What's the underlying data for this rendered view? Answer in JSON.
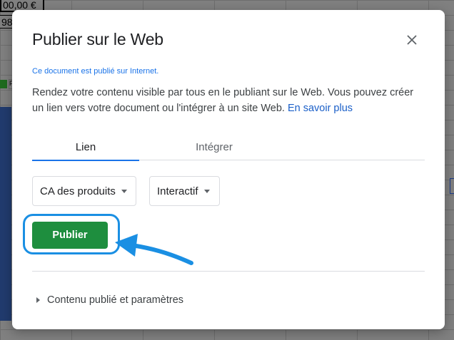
{
  "background": {
    "cell_value_1": "00,00 €",
    "cell_value_2": "98,",
    "legend_letter": "F"
  },
  "dialog": {
    "title": "Publier sur le Web",
    "close_icon": "close-icon",
    "status_text": "Ce document est publié sur Internet.",
    "description": "Rendez votre contenu visible par tous en le publiant sur le Web. Vous pouvez créer un lien vers votre document ou l'intégrer à un site Web.",
    "learn_more_link": "En savoir plus",
    "tabs": [
      {
        "label": "Lien",
        "active": true
      },
      {
        "label": "Intégrer",
        "active": false
      }
    ],
    "sheet_select": {
      "value": "CA des produits"
    },
    "mode_select": {
      "value": "Interactif"
    },
    "publish_button": "Publier",
    "published_settings": "Contenu publié et paramètres"
  },
  "colors": {
    "accent_blue": "#1a73e8",
    "publish_green": "#1e8e3e",
    "annotation_blue": "#1a8fe3"
  }
}
